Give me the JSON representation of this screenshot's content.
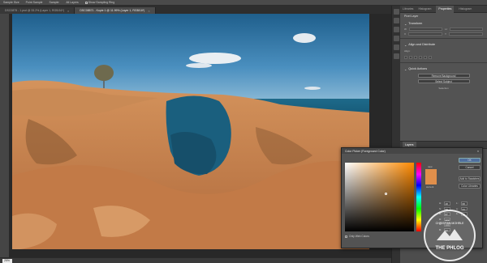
{
  "options_bar": {
    "items": [
      "Sample Size",
      "Point Sample",
      "Sample:",
      "All Layers",
      "Show Sampling Ring"
    ]
  },
  "tabs": [
    {
      "label": "DSC0875 - 1.psd @ 33.2% (Layer 1, RGB/16*)",
      "active": false
    },
    {
      "label": "DSC08571 - Kopie 1 @ 11.99% (Layer 1, RGB/16*)",
      "active": true
    }
  ],
  "status": {
    "zoom": "25%"
  },
  "panel": {
    "tabs": [
      "Libraries",
      "Histogram",
      "Properties",
      "Histogram"
    ],
    "active_tab": "Properties",
    "pixel_layer": "Pixel Layer",
    "transform": "Transform",
    "w_label": "W",
    "h_label": "H",
    "x_label": "X",
    "y_label": "Y",
    "align": "Align and Distribute",
    "align_sub": "Align:",
    "quick_actions": "Quick Actions",
    "remove_bg": "Remove Background",
    "select_subject": "Select Subject",
    "more": "Selection",
    "layers_tab": "Layers"
  },
  "color_picker": {
    "title": "Color Picker (Foreground Color)",
    "close": "×",
    "new_label": "new",
    "current_label": "current",
    "buttons": [
      "OK",
      "Cancel",
      "Add to Swatches",
      "Color Libraries"
    ],
    "values": [
      {
        "label": "H:",
        "value": "28"
      },
      {
        "label": "S:",
        "value": "58"
      },
      {
        "label": "B:",
        "value": "87"
      },
      {
        "label": "R:",
        "value": "222"
      },
      {
        "label": "G:",
        "value": "144"
      },
      {
        "label": "B:",
        "value": "92"
      }
    ],
    "lab_values": [
      {
        "label": "L:",
        "value": "68"
      },
      {
        "label": "a:",
        "value": "24"
      },
      {
        "label": "b:",
        "value": "46"
      }
    ],
    "web_only": "Only Web Colors",
    "selected_color": "#e08f4b"
  },
  "watermark": {
    "text": "THE PHLOG",
    "sub": "CHRISTIAN MOHRLE"
  }
}
